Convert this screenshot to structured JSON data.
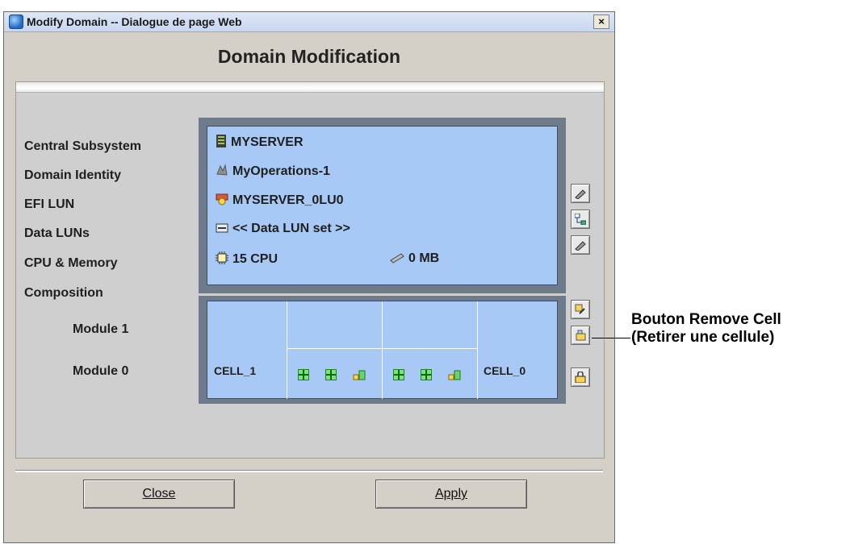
{
  "window": {
    "title": "Modify Domain -- Dialogue de page Web",
    "close_glyph": "×"
  },
  "heading": "Domain Modification",
  "labels": {
    "central_subsystem": "Central Subsystem",
    "domain_identity": "Domain Identity",
    "efi_lun": "EFI LUN",
    "data_luns": "Data LUNs",
    "cpu_memory": "CPU & Memory",
    "composition": "Composition",
    "module_1": "Module 1",
    "module_0": "Module 0"
  },
  "values": {
    "central_subsystem": "MYSERVER",
    "domain_identity": "MyOperations-1",
    "efi_lun": "MYSERVER_0LU0",
    "data_luns": "<< Data LUN set >>",
    "cpu": "15 CPU",
    "memory": "0 MB"
  },
  "composition": {
    "cell_left": "CELL_1",
    "cell_right": "CELL_0"
  },
  "buttons": {
    "close": "Close",
    "apply": "Apply"
  },
  "callout": {
    "line1": "Bouton Remove Cell",
    "line2": "(Retirer une cellule)"
  },
  "icons": [
    "server-icon",
    "identity-icon",
    "efi-lun-icon",
    "data-lun-icon",
    "cpu-icon",
    "memory-icon",
    "cpu-module-icon",
    "tree-icon",
    "edit-icon",
    "network-icon",
    "lock-icon"
  ]
}
